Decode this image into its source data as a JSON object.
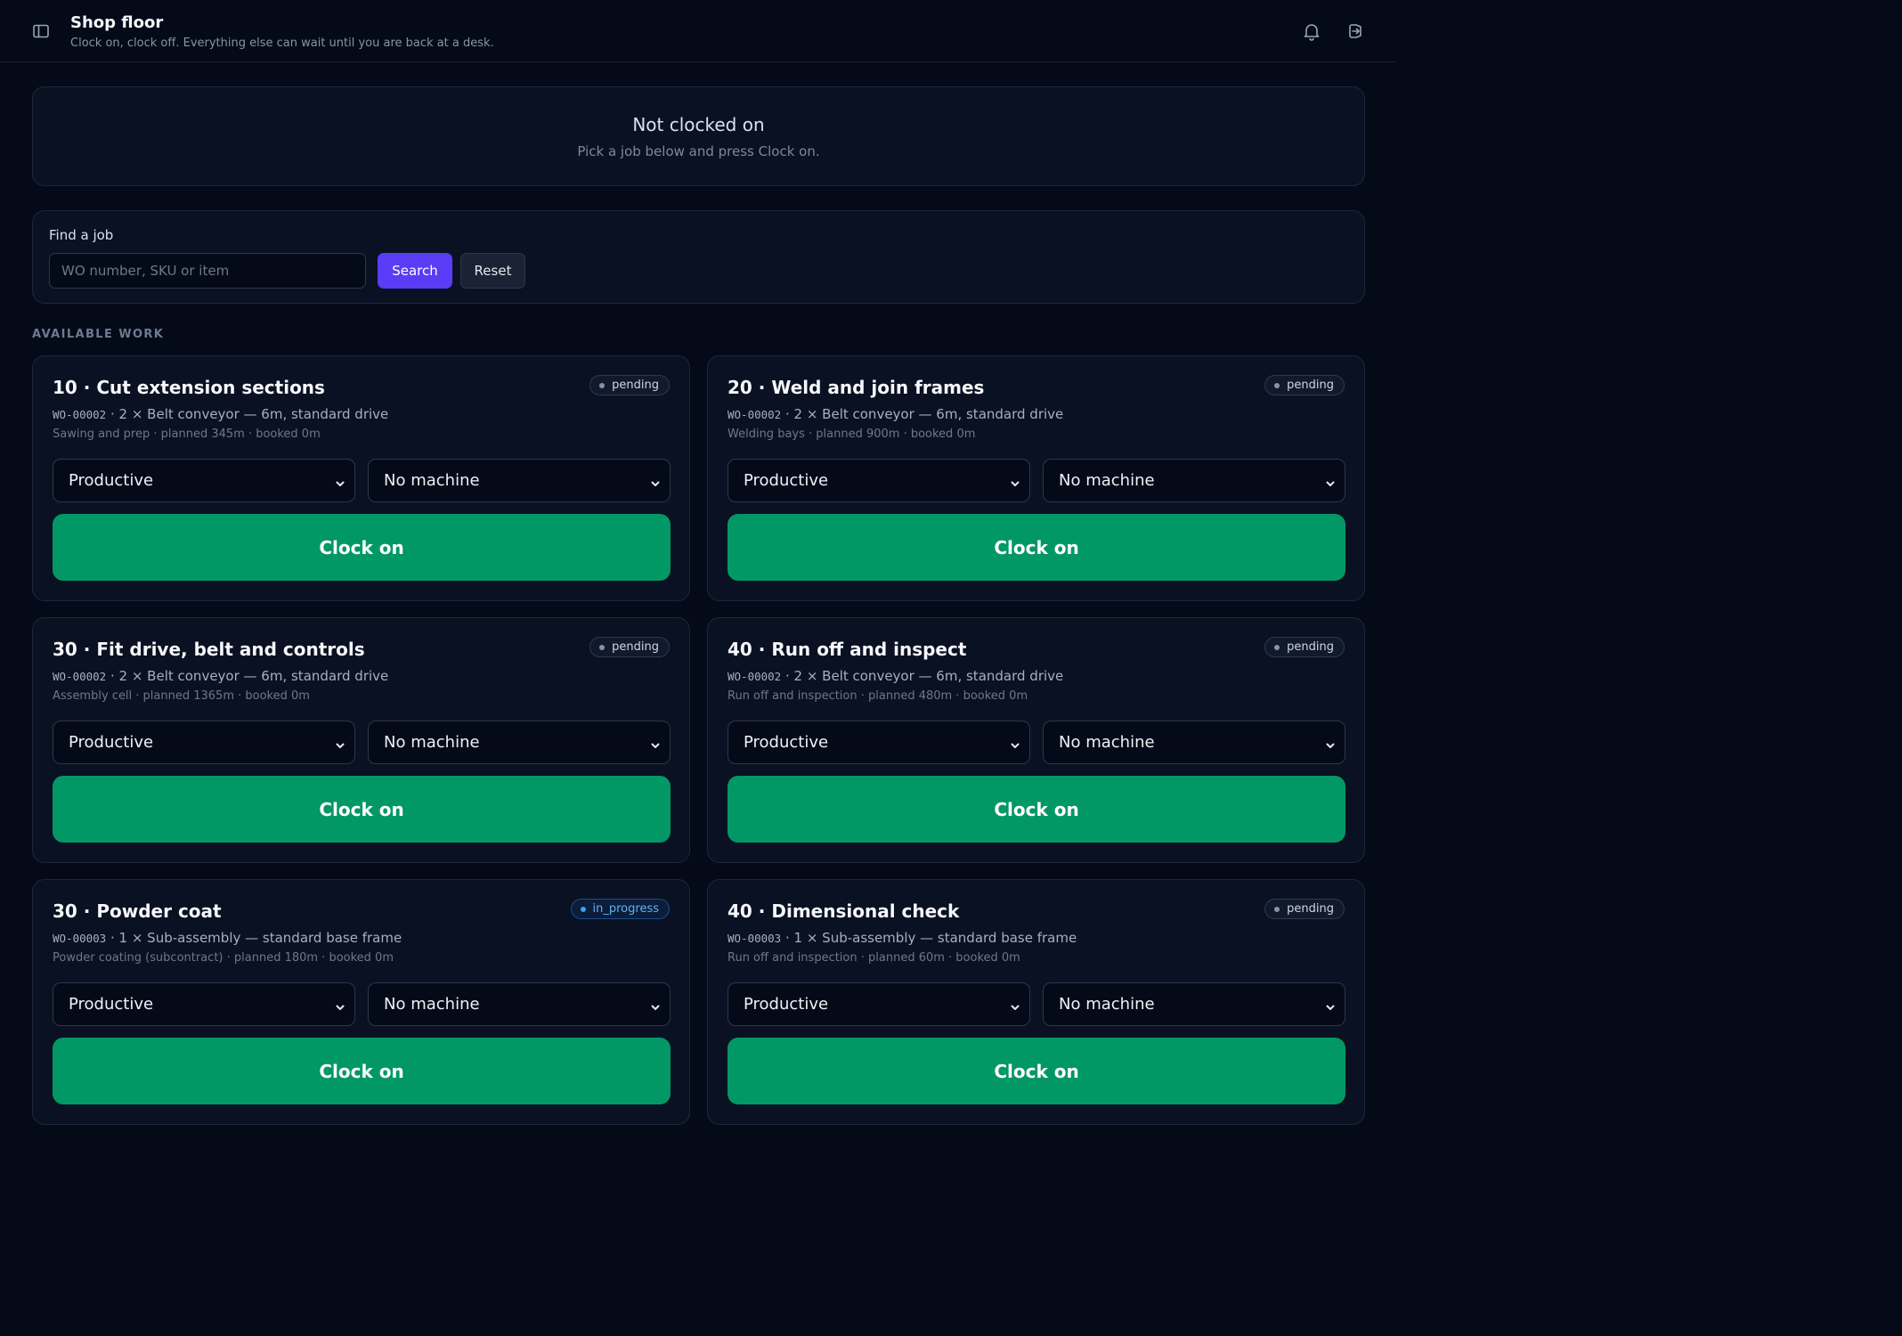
{
  "header": {
    "title": "Shop floor",
    "subtitle": "Clock on, clock off. Everything else can wait until you are back at a desk.",
    "icons": [
      "sidebar-toggle-icon",
      "bell-icon",
      "sign-out-icon"
    ]
  },
  "status": {
    "title": "Not clocked on",
    "hint": "Pick a job below and press Clock on."
  },
  "search": {
    "label": "Find a job",
    "placeholder": "WO number, SKU or item",
    "value": "",
    "search_label": "Search",
    "reset_label": "Reset"
  },
  "section": {
    "heading": "AVAILABLE WORK"
  },
  "colors": {
    "background": "#050a18",
    "card": "#0a1122",
    "accent": "#5b3cf6",
    "clock_on": "#029866",
    "in_progress": "#3aa0f0"
  },
  "operations": [
    {
      "title": "10 · Cut extension sections",
      "status": "pending",
      "wo": "WO-00002",
      "item": " · 2 × Belt conveyor — 6m, standard drive",
      "sub": "Sawing and prep · planned 345m · booked 0m",
      "category": "Productive",
      "machine": "No machine",
      "action": "Clock on"
    },
    {
      "title": "20 · Weld and join frames",
      "status": "pending",
      "wo": "WO-00002",
      "item": " · 2 × Belt conveyor — 6m, standard drive",
      "sub": "Welding bays · planned 900m · booked 0m",
      "category": "Productive",
      "machine": "No machine",
      "action": "Clock on"
    },
    {
      "title": "30 · Fit drive, belt and controls",
      "status": "pending",
      "wo": "WO-00002",
      "item": " · 2 × Belt conveyor — 6m, standard drive",
      "sub": "Assembly cell · planned 1365m · booked 0m",
      "category": "Productive",
      "machine": "No machine",
      "action": "Clock on"
    },
    {
      "title": "40 · Run off and inspect",
      "status": "pending",
      "wo": "WO-00002",
      "item": " · 2 × Belt conveyor — 6m, standard drive",
      "sub": "Run off and inspection · planned 480m · booked 0m",
      "category": "Productive",
      "machine": "No machine",
      "action": "Clock on"
    },
    {
      "title": "30 · Powder coat",
      "status": "in_progress",
      "wo": "WO-00003",
      "item": " · 1 × Sub-assembly — standard base frame",
      "sub": "Powder coating (subcontract) · planned 180m · booked 0m",
      "category": "Productive",
      "machine": "No machine",
      "action": "Clock on"
    },
    {
      "title": "40 · Dimensional check",
      "status": "pending",
      "wo": "WO-00003",
      "item": " · 1 × Sub-assembly — standard base frame",
      "sub": "Run off and inspection · planned 60m · booked 0m",
      "category": "Productive",
      "machine": "No machine",
      "action": "Clock on"
    }
  ]
}
